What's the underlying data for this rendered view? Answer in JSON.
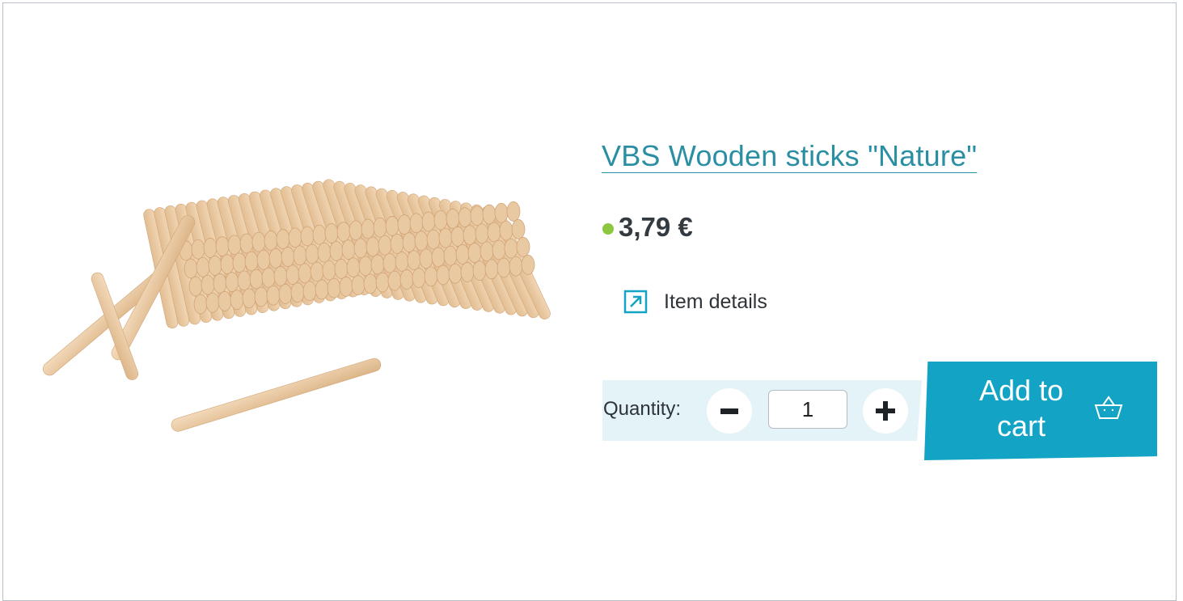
{
  "product": {
    "title": "VBS Wooden sticks \"Nature\"",
    "price": "3,79 €",
    "details_label": "Item details",
    "image_icon": "wooden-sticks-image"
  },
  "quantity": {
    "label": "Quantity:",
    "value": "1",
    "minus_icon": "minus-icon",
    "plus_icon": "plus-icon"
  },
  "cart": {
    "add_label_line1": "Add to",
    "add_label_line2": "cart",
    "icon": "basket-icon"
  },
  "colors": {
    "accent": "#12a3c5",
    "title": "#2b8fa3",
    "stock_dot": "#8dc63f",
    "qty_band": "#e3f3f8"
  }
}
